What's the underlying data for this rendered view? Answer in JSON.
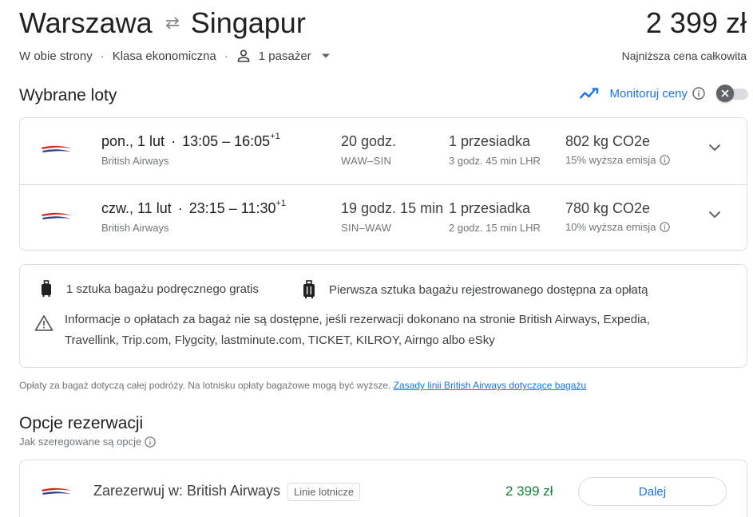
{
  "trip": {
    "origin": "Warszawa",
    "destination": "Singapur",
    "swap_icon": "swap-arrows-icon",
    "total_price": "2 399 zł",
    "price_caption": "Najniższa cena całkowita",
    "trip_type": "W obie strony",
    "cabin_class": "Klasa ekonomiczna",
    "passengers": "1 pasażer"
  },
  "selected": {
    "title": "Wybrane loty",
    "monitor_label": "Monitoruj ceny"
  },
  "flights": [
    {
      "date": "pon., 1 lut",
      "depart": "13:05",
      "arrive": "16:05",
      "day_offset": "+1",
      "airline": "British Airways",
      "duration": "20 godz.",
      "route": "WAW–SIN",
      "stops": "1 przesiadka",
      "layover": "3 godz. 45 min LHR",
      "co2": "802 kg CO2e",
      "emission": "15% wyższa emisja"
    },
    {
      "date": "czw., 11 lut",
      "depart": "23:15",
      "arrive": "11:30",
      "day_offset": "+1",
      "airline": "British Airways",
      "duration": "19 godz. 15 min",
      "route": "SIN–WAW",
      "stops": "1 przesiadka",
      "layover": "2 godz. 15 min LHR",
      "co2": "780 kg CO2e",
      "emission": "10% wyższa emisja"
    }
  ],
  "baggage": {
    "carry_on": "1 sztuka bagażu podręcznego gratis",
    "checked": "Pierwsza sztuka bagażu rejestrowanego dostępna za opłatą",
    "warning": "Informacje o opłatach za bagaż nie są dostępne, jeśli rezerwacji dokonano na stronie British Airways, Expedia, Travellink, Trip.com, Flygcity, lastminute.com, TICKET, KILROY, Airngo albo eSky",
    "note": "Opłaty za bagaż dotyczą całej podróży. Na lotnisku opłaty bagażowe mogą być wyższe.",
    "policy_link": "Zasady linii British Airways dotyczące bagażu"
  },
  "booking": {
    "title": "Opcje rezerwacji",
    "subtitle": "Jak szeregowane są opcje",
    "label": "Zarezerwuj w: British Airways",
    "badge": "Linie lotnicze",
    "price": "2 399 zł",
    "button": "Dalej"
  },
  "colors": {
    "accent": "#1a73e8",
    "price_green": "#188038",
    "border": "#dadce0",
    "ba_red": "#d52b1e",
    "ba_blue": "#2e3a8c"
  }
}
